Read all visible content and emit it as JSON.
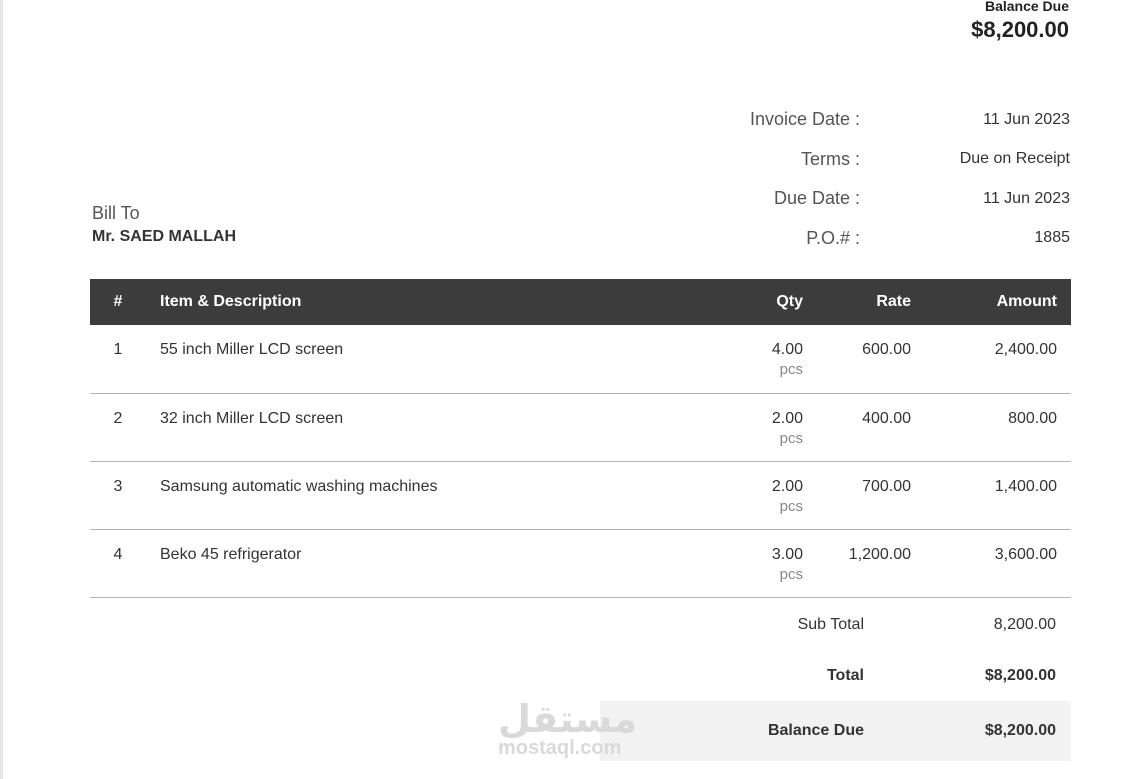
{
  "balance_header": {
    "label": "Balance Due",
    "amount": "$8,200.00"
  },
  "meta": [
    {
      "key": "Invoice Date :",
      "value": "11 Jun 2023"
    },
    {
      "key": "Terms :",
      "value": "Due on Receipt"
    },
    {
      "key": "Due Date :",
      "value": "11 Jun 2023"
    },
    {
      "key": "P.O.# :",
      "value": "1885"
    }
  ],
  "bill_to": {
    "label": "Bill To",
    "name": "Mr. SAED MALLAH"
  },
  "table": {
    "headers": {
      "num": "#",
      "desc": "Item & Description",
      "qty": "Qty",
      "rate": "Rate",
      "amount": "Amount"
    },
    "rows": [
      {
        "num": "1",
        "desc": "55 inch Miller LCD screen",
        "qty": "4.00",
        "unit": "pcs",
        "rate": "600.00",
        "amount": "2,400.00"
      },
      {
        "num": "2",
        "desc": "32 inch Miller LCD screen",
        "qty": "2.00",
        "unit": "pcs",
        "rate": "400.00",
        "amount": "800.00"
      },
      {
        "num": "3",
        "desc": "Samsung automatic washing machines",
        "qty": "2.00",
        "unit": "pcs",
        "rate": "700.00",
        "amount": "1,400.00"
      },
      {
        "num": "4",
        "desc": "Beko 45 refrigerator",
        "qty": "3.00",
        "unit": "pcs",
        "rate": "1,200.00",
        "amount": "3,600.00"
      }
    ]
  },
  "totals": {
    "subtotal_label": "Sub Total",
    "subtotal_value": "8,200.00",
    "total_label": "Total",
    "total_value": "$8,200.00",
    "balance_label": "Balance Due",
    "balance_value": "$8,200.00"
  },
  "watermark": {
    "arabic": "مستقل",
    "latin": "mostaql.com"
  }
}
